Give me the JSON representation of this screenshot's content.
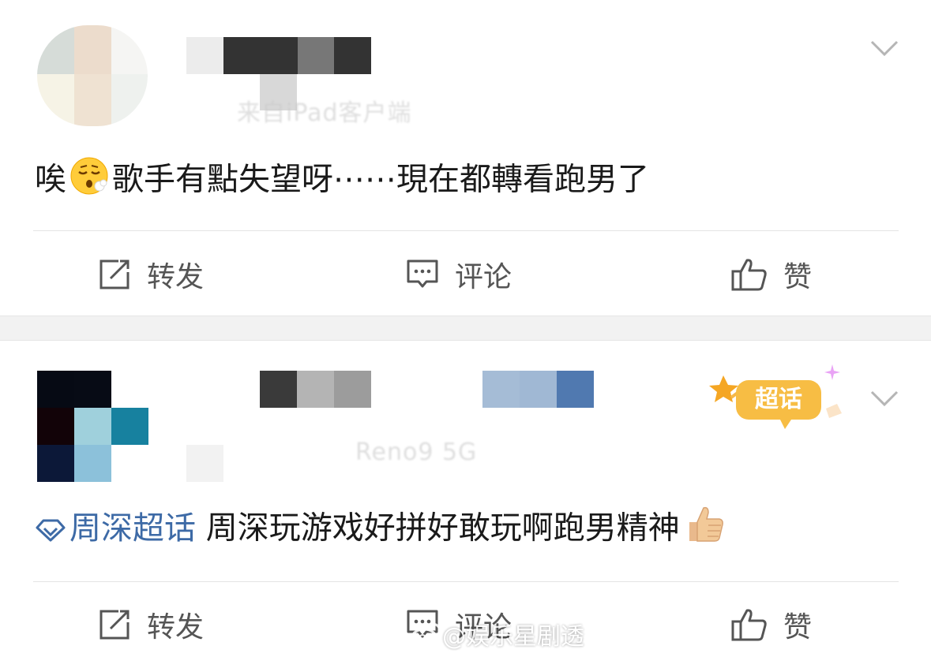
{
  "posts": [
    {
      "content_text": "唉😮‍💨歌手有點失望呀⋯⋯現在都轉看跑男了",
      "content_prefix": "唉",
      "content_suffix": "歌手有點失望呀⋯⋯現在都轉看跑男了",
      "meta_text": "来自iPad客户端",
      "actions": {
        "repost": "转发",
        "comment": "评论",
        "like": "赞"
      }
    },
    {
      "topic_label": "周深超话",
      "content_text": "周深玩游戏好拼好敢玩啊跑男精神",
      "meta_text": "Reno9 5G",
      "badge_label": "超话",
      "actions": {
        "repost": "转发",
        "comment": "评论",
        "like": "赞"
      }
    }
  ],
  "watermark": "@娱乐星剧透",
  "icons": {
    "chevron": "chevron-down-icon",
    "repost": "repost-icon",
    "comment": "comment-icon",
    "like": "thumbs-up-icon",
    "topic": "super-topic-diamond-icon",
    "weibo": "weibo-logo-icon"
  },
  "colors": {
    "topic_blue": "#3d6aa6",
    "action_gray": "#555555",
    "divider": "#f2f2f2",
    "badge_orange": "#f5a623"
  }
}
